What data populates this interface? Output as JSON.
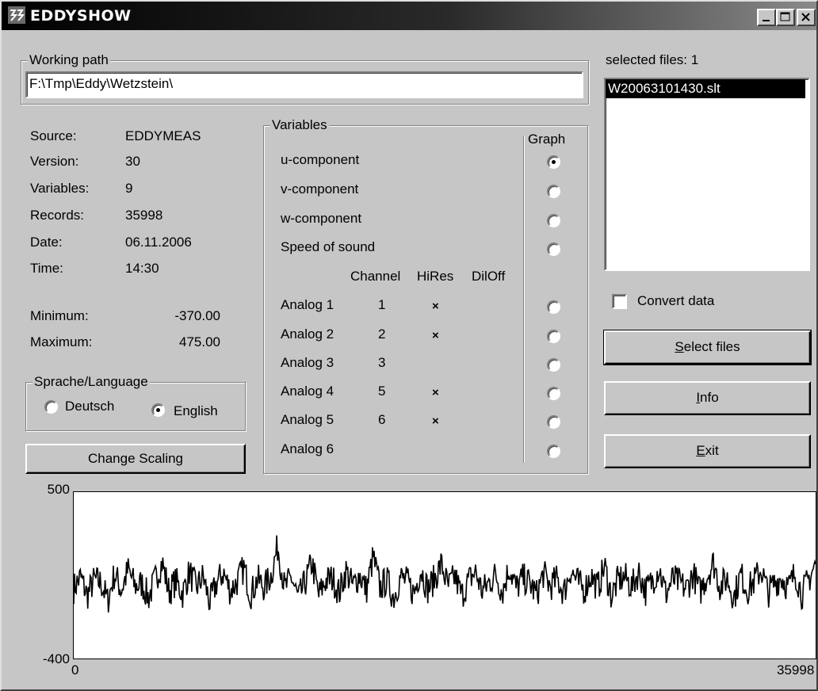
{
  "window": {
    "title": "EDDYSHOW",
    "controls": [
      "minimize",
      "maximize",
      "close"
    ]
  },
  "working_path": {
    "legend": "Working path",
    "value": "F:\\Tmp\\Eddy\\Wetzstein\\"
  },
  "info": {
    "rows": [
      {
        "label": "Source:",
        "value": "EDDYMEAS"
      },
      {
        "label": "Version:",
        "value": "30"
      },
      {
        "label": "Variables:",
        "value": "9"
      },
      {
        "label": "Records:",
        "value": "35998"
      },
      {
        "label": "Date:",
        "value": "06.11.2006"
      },
      {
        "label": "Time:",
        "value": "14:30"
      }
    ],
    "minimum_label": "Minimum:",
    "minimum_value": "-370.00",
    "maximum_label": "Maximum:",
    "maximum_value": "475.00"
  },
  "language": {
    "legend": "Sprache/Language",
    "options": [
      {
        "label": "Deutsch",
        "selected": false
      },
      {
        "label": "English",
        "selected": true
      }
    ]
  },
  "change_scaling_label": "Change Scaling",
  "variables": {
    "legend": "Variables",
    "graph_header": "Graph",
    "basic": [
      {
        "label": "u-component",
        "graph": true
      },
      {
        "label": "v-component",
        "graph": false
      },
      {
        "label": "w-component",
        "graph": false
      },
      {
        "label": "Speed of sound",
        "graph": false
      }
    ],
    "analog_headers": {
      "channel": "Channel",
      "hires": "HiRes",
      "diloff": "DilOff"
    },
    "analog": [
      {
        "label": "Analog 1",
        "channel": "1",
        "hires": "×",
        "graph": false
      },
      {
        "label": "Analog 2",
        "channel": "2",
        "hires": "×",
        "graph": false
      },
      {
        "label": "Analog 3",
        "channel": "3",
        "hires": "",
        "graph": false
      },
      {
        "label": "Analog 4",
        "channel": "5",
        "hires": "×",
        "graph": false
      },
      {
        "label": "Analog 5",
        "channel": "6",
        "hires": "×",
        "graph": false
      },
      {
        "label": "Analog 6",
        "channel": "",
        "hires": "",
        "graph": false
      }
    ]
  },
  "files": {
    "header": "selected files: 1",
    "items": [
      {
        "name": "W20063101430.slt",
        "selected": true
      }
    ]
  },
  "convert_data": {
    "label": "Convert data",
    "checked": false
  },
  "buttons": {
    "select_files": {
      "label": "Select files",
      "mnemonic": "S",
      "rest": "elect files"
    },
    "info": {
      "label": "Info",
      "mnemonic": "I",
      "rest": "nfo"
    },
    "exit": {
      "label": "Exit",
      "mnemonic": "E",
      "rest": "xit"
    }
  },
  "chart_data": {
    "type": "line",
    "series": [
      {
        "values": [
          -20,
          40,
          -60,
          25,
          10,
          -90,
          60,
          -30,
          80,
          -10,
          5,
          -70,
          30,
          120,
          -40,
          20,
          -50,
          70,
          -20,
          45,
          -100,
          10,
          65,
          -35,
          15,
          90,
          -55,
          30,
          -15,
          50,
          210,
          -25,
          40,
          -80,
          10,
          120,
          -60,
          20,
          35,
          -45,
          75,
          -10,
          55,
          -30,
          150,
          -20,
          25,
          -70,
          40,
          15,
          -50,
          85,
          -25,
          30,
          110,
          -15,
          45,
          -60,
          20,
          70,
          -35,
          10,
          55,
          -40,
          95,
          -20,
          35,
          5,
          -55,
          60,
          -10,
          30,
          -45,
          80,
          15,
          -30,
          50,
          -20,
          100,
          -65,
          25,
          40,
          -15,
          70,
          -35,
          20,
          90,
          -50,
          30,
          10,
          -25,
          60,
          -40,
          45,
          120,
          -15,
          35,
          -70,
          55,
          -30,
          20,
          85,
          -45,
          10,
          40,
          -20,
          65,
          -55,
          30,
          110
        ]
      }
    ],
    "x": [
      0,
      35998
    ],
    "xlim": [
      0,
      35998
    ],
    "ylim": [
      -400,
      500
    ],
    "ytick_labels": [
      "500",
      "-400"
    ],
    "xtick_labels": [
      "0",
      "35998"
    ],
    "grid": false
  }
}
